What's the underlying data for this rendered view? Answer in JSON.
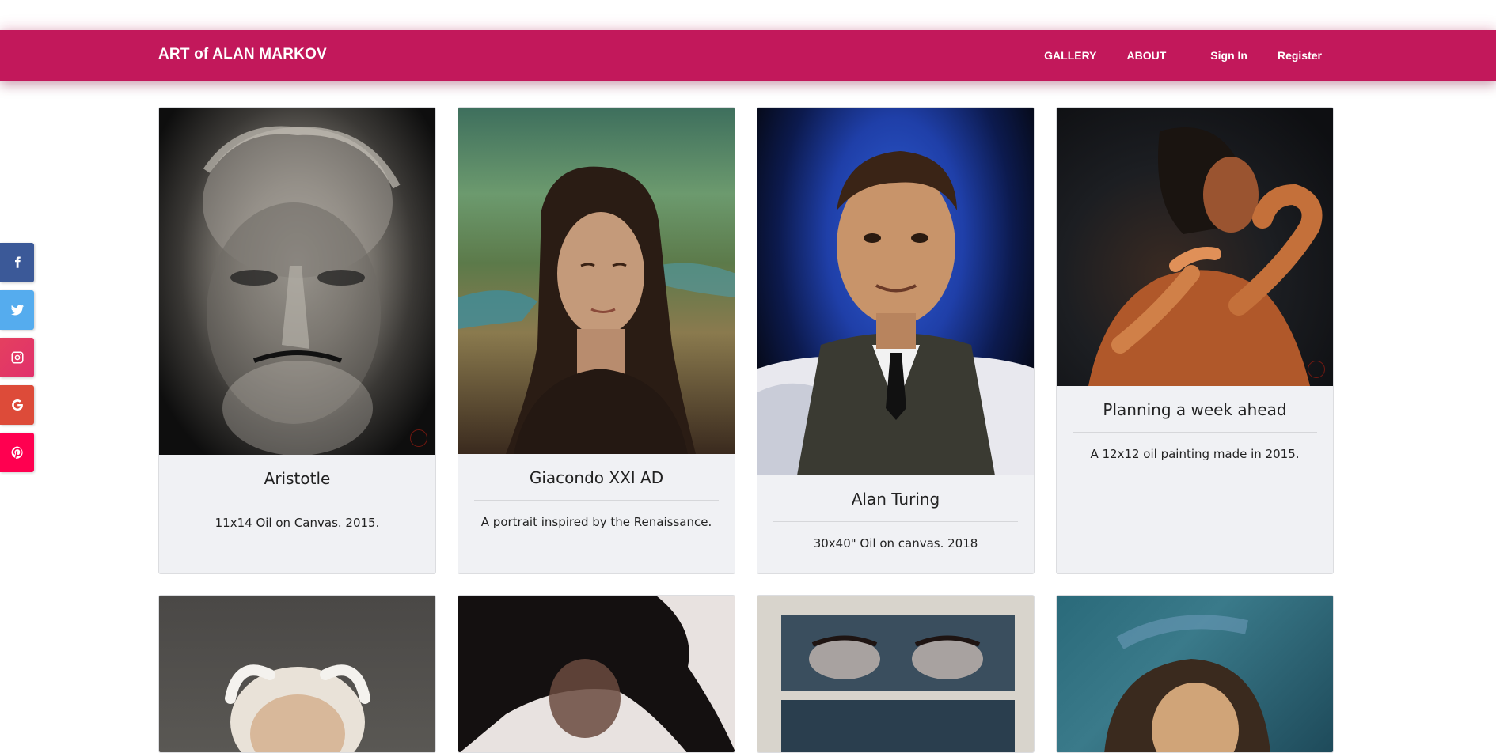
{
  "header": {
    "brand": "ART of ALAN MARKOV",
    "nav": {
      "gallery": "GALLERY",
      "about": "ABOUT",
      "signin": "Sign In",
      "register": "Register"
    },
    "colors": {
      "primary": "#c2185b"
    }
  },
  "social": [
    {
      "name": "facebook-icon",
      "color": "#3b5998"
    },
    {
      "name": "twitter-icon",
      "color": "#55acee"
    },
    {
      "name": "instagram-icon",
      "color": "#e1306c"
    },
    {
      "name": "google-icon",
      "color": "#dd4b39"
    },
    {
      "name": "pinterest-icon",
      "color": "#ff0050"
    }
  ],
  "gallery": {
    "items": [
      {
        "title": "Aristotle",
        "description": "11x14 Oil on Canvas. 2015."
      },
      {
        "title": "Giacondo XXI AD",
        "description": "A portrait inspired by the Renaissance."
      },
      {
        "title": "Alan Turing",
        "description": "30x40\" Oil on canvas. 2018"
      },
      {
        "title": "Planning a week ahead",
        "description": "A 12x12 oil painting made in 2015."
      },
      {
        "title": "",
        "description": ""
      },
      {
        "title": "",
        "description": ""
      },
      {
        "title": "",
        "description": ""
      },
      {
        "title": "",
        "description": ""
      }
    ]
  }
}
